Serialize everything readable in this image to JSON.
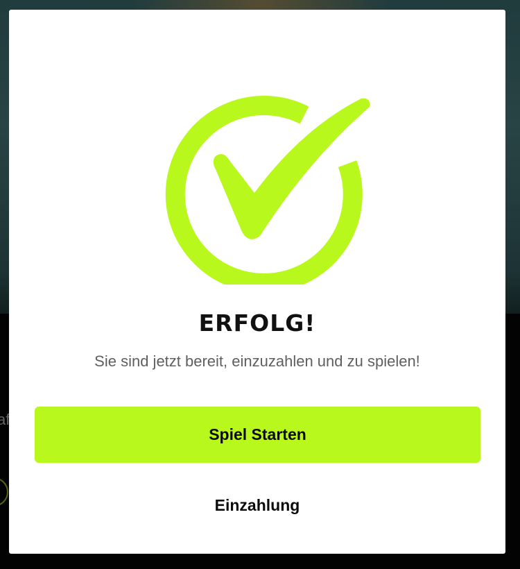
{
  "modal": {
    "title": "ERFOLG!",
    "message": "Sie sind jetzt bereit, einzuzahlen und zu spielen!",
    "primary_button_label": "Spiel Starten",
    "secondary_button_label": "Einzahlung",
    "icon": "check-circle-icon",
    "accent_color": "#b9f81c"
  },
  "background": {
    "peek_text": "af"
  }
}
